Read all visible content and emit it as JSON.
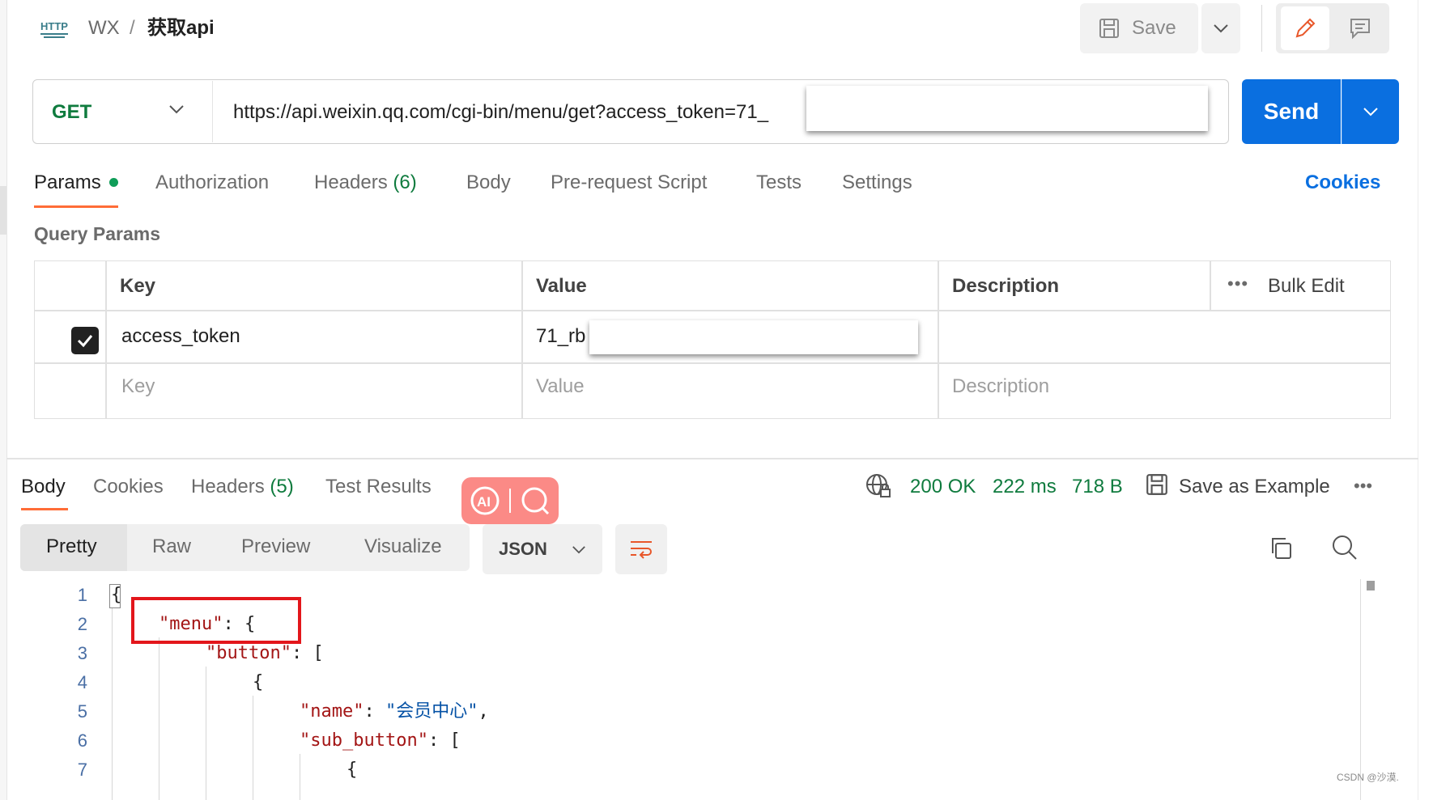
{
  "header": {
    "icon": "http-icon",
    "workspace": "WX",
    "separator": "/",
    "title": "获取api",
    "save_label": "Save"
  },
  "request": {
    "method": "GET",
    "url": "https://api.weixin.qq.com/cgi-bin/menu/get?access_token=71_",
    "send_label": "Send",
    "tabs": [
      {
        "label": "Params"
      },
      {
        "label": "Authorization"
      },
      {
        "label": "Headers",
        "count": "(6)"
      },
      {
        "label": "Body"
      },
      {
        "label": "Pre-request Script"
      },
      {
        "label": "Tests"
      },
      {
        "label": "Settings"
      }
    ],
    "cookies_label": "Cookies"
  },
  "params": {
    "title": "Query Params",
    "columns": {
      "key": "Key",
      "value": "Value",
      "description": "Description"
    },
    "bulk_edit": "Bulk Edit",
    "more": "•••",
    "rows": [
      {
        "checked": true,
        "key": "access_token",
        "value": "71_rb",
        "description": ""
      }
    ],
    "empty_row": {
      "key": "Key",
      "value": "Value",
      "description": "Description"
    }
  },
  "response": {
    "tabs": [
      {
        "label": "Body"
      },
      {
        "label": "Cookies"
      },
      {
        "label": "Headers",
        "count": "(5)"
      },
      {
        "label": "Test Results"
      }
    ],
    "status": "200 OK",
    "time": "222 ms",
    "size": "718 B",
    "save_example": "Save as Example",
    "more": "•••",
    "views": [
      "Pretty",
      "Raw",
      "Preview",
      "Visualize"
    ],
    "format": "JSON",
    "line_numbers": [
      "1",
      "2",
      "3",
      "4",
      "5",
      "6",
      "7"
    ],
    "code": {
      "l1": "{",
      "l2_key": "\"menu\"",
      "l2_rest": ": {",
      "l3_key": "\"button\"",
      "l3_rest": ": [",
      "l4": "{",
      "l5_key": "\"name\"",
      "l5_colon": ": ",
      "l5_val": "\"会员中心\"",
      "l5_comma": ",",
      "l6_key": "\"sub_button\"",
      "l6_rest": ": [",
      "l7": "{"
    }
  },
  "watermark": "CSDN @沙漠."
}
